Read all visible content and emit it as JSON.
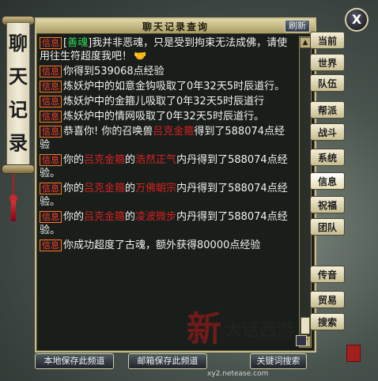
{
  "side_title": [
    "聊",
    "天",
    "记",
    "录"
  ],
  "window": {
    "title": "聊天记录查询",
    "refresh": "刷新"
  },
  "messages": [
    {
      "tag": "信息",
      "parts": [
        {
          "t": "[",
          "c": ""
        },
        {
          "t": "善魂",
          "c": "green"
        },
        {
          "t": "]我并非恶魂，只是受到拘束无法成佛，请使用往生符超度我吧！",
          "c": ""
        }
      ],
      "emote": "🤝"
    },
    {
      "tag": "信息",
      "parts": [
        {
          "t": "你得到539068点经验",
          "c": ""
        }
      ]
    },
    {
      "tag": "信息",
      "parts": [
        {
          "t": "炼妖炉中的如意金钩吸取了0年32天5时辰道行。",
          "c": ""
        }
      ]
    },
    {
      "tag": "信息",
      "parts": [
        {
          "t": "炼妖炉中的金箍儿吸取了0年32天5时辰道行",
          "c": ""
        }
      ]
    },
    {
      "tag": "信息",
      "parts": [
        {
          "t": "炼妖炉中的情网吸取了0年32天5时辰道行。",
          "c": ""
        }
      ]
    },
    {
      "tag": "信息",
      "parts": [
        {
          "t": "恭喜你! 你的召唤兽",
          "c": ""
        },
        {
          "t": "吕克金箍",
          "c": "red"
        },
        {
          "t": "得到了588074点经验",
          "c": ""
        }
      ]
    },
    {
      "tag": "信息",
      "parts": [
        {
          "t": "你的",
          "c": ""
        },
        {
          "t": "吕克金箍",
          "c": "red"
        },
        {
          "t": "的",
          "c": ""
        },
        {
          "t": "浩然正气",
          "c": "red"
        },
        {
          "t": "内丹得到了588074点经验。",
          "c": ""
        }
      ]
    },
    {
      "tag": "信息",
      "parts": [
        {
          "t": "你的",
          "c": ""
        },
        {
          "t": "吕克金箍",
          "c": "red"
        },
        {
          "t": "的",
          "c": ""
        },
        {
          "t": "万佛朝宗",
          "c": "red"
        },
        {
          "t": "内丹得到了588074点经验。",
          "c": ""
        }
      ]
    },
    {
      "tag": "信息",
      "parts": [
        {
          "t": "你的",
          "c": ""
        },
        {
          "t": "吕克金箍",
          "c": "red"
        },
        {
          "t": "的",
          "c": ""
        },
        {
          "t": "凌波微步",
          "c": "red"
        },
        {
          "t": "内丹得到了588074点经验。",
          "c": ""
        }
      ]
    },
    {
      "tag": "信息",
      "parts": [
        {
          "t": "你成功超度了古魂，额外获得80000点经验",
          "c": ""
        }
      ]
    }
  ],
  "tabs": [
    "当前",
    "世界",
    "队伍",
    "帮派",
    "战斗",
    "系统",
    "信息",
    "祝福",
    "团队",
    "传音",
    "贸易",
    "搜索"
  ],
  "active_tab": "信息",
  "bottom_buttons": {
    "save_local": "本地保存此频道",
    "mail_save": "邮箱保存此频道",
    "keyword_search": "关键词搜索"
  },
  "watermark": {
    "main": "新",
    "sub": "大话西游",
    "site_label": "论坛",
    "url": "xy2.netease.com"
  },
  "close_label": "X"
}
